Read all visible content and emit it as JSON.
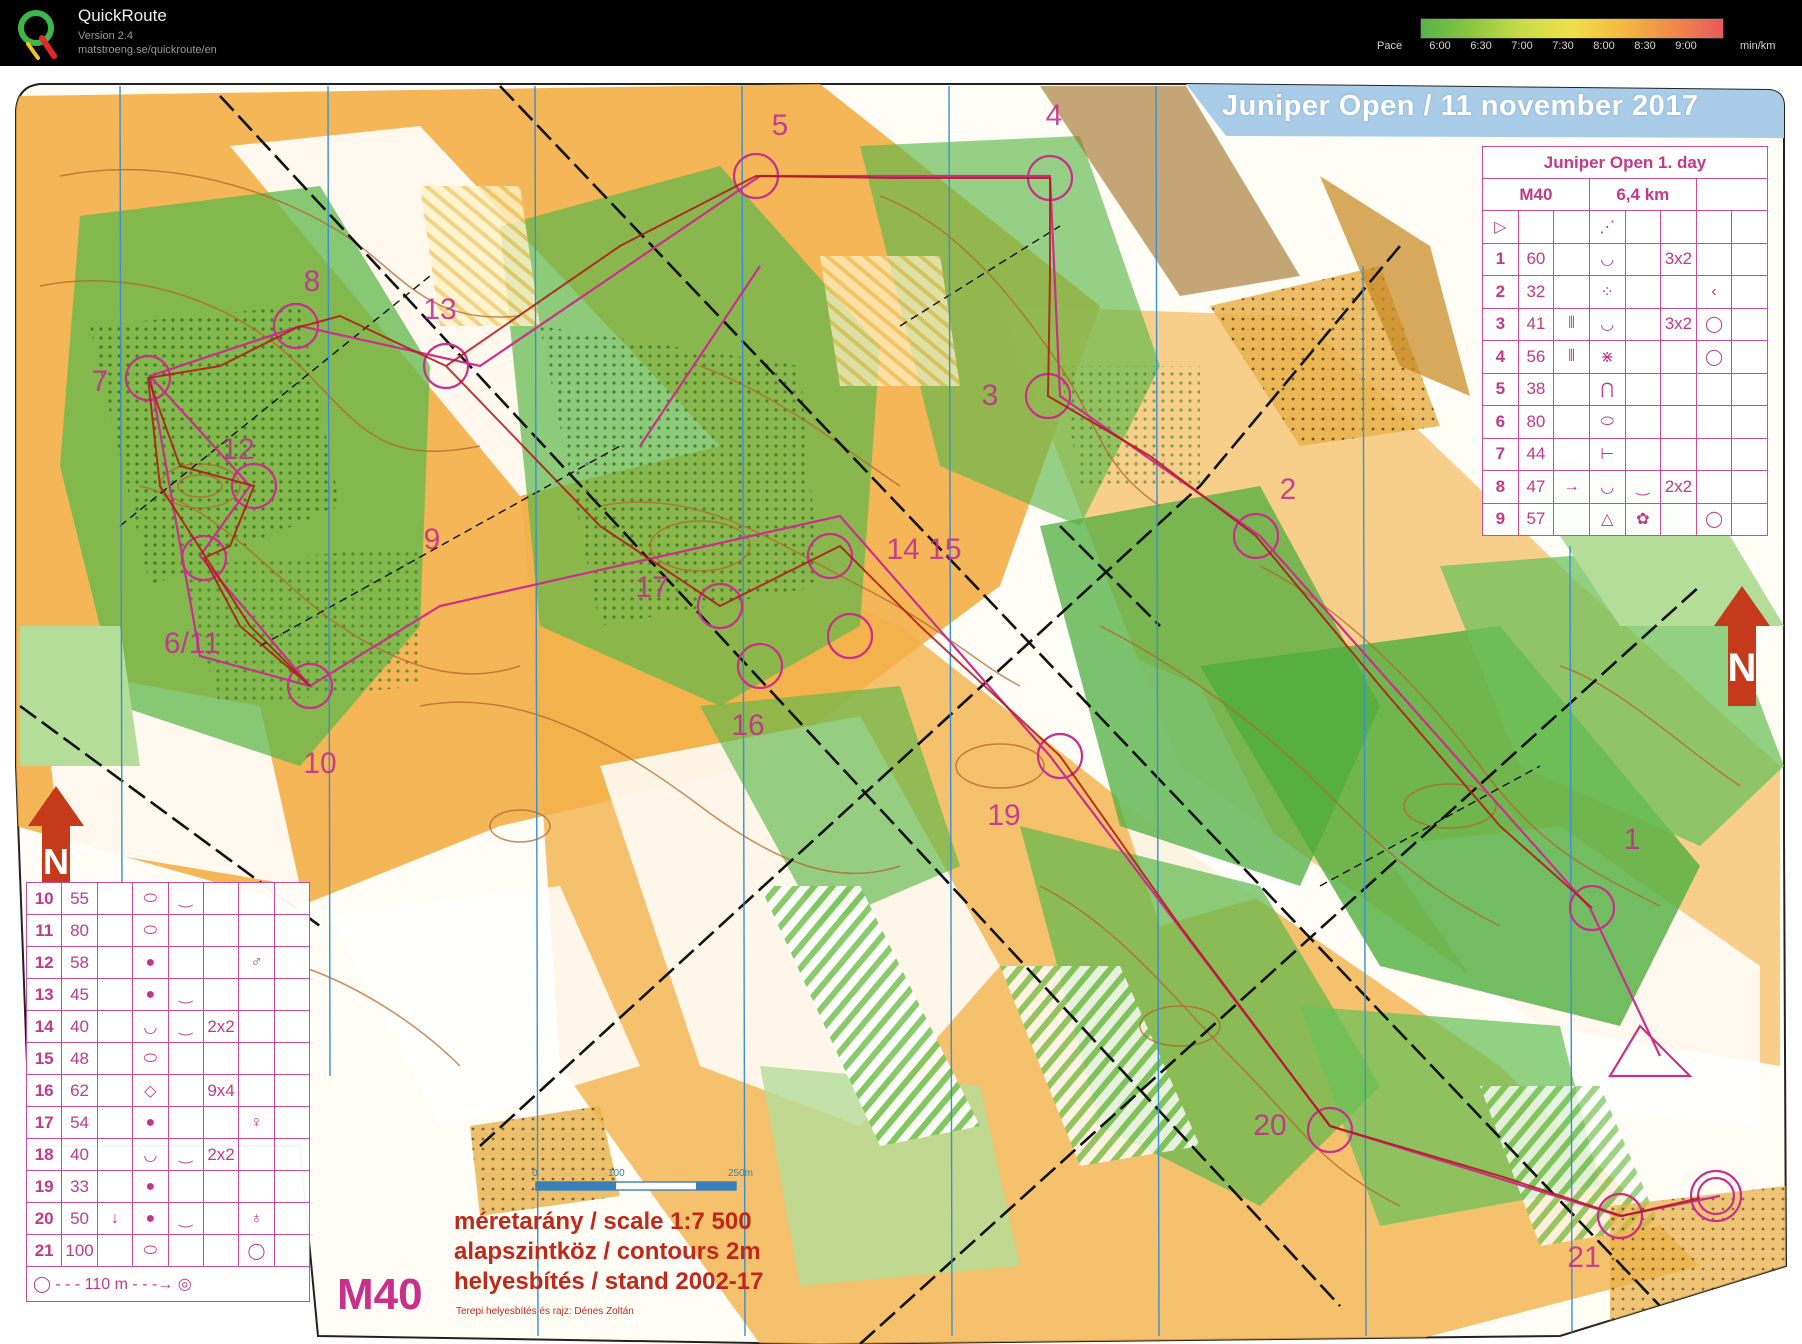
{
  "app": {
    "name": "QuickRoute",
    "version": "Version 2.4",
    "url": "matstroeng.se/quickroute/en"
  },
  "pace_scale": {
    "label": "Pace",
    "unit": "min/km",
    "ticks": [
      "6:00",
      "6:30",
      "7:00",
      "7:30",
      "8:00",
      "8:30",
      "9:00"
    ],
    "colors": [
      "#55b34a",
      "#8cc63f",
      "#c7dc4a",
      "#efe04a",
      "#f4b942",
      "#f08a4b",
      "#e85a5a"
    ]
  },
  "map": {
    "event_title": "Juniper Open  /  11 november 2017",
    "course_header": "Juniper Open 1. day",
    "course_class": "M40",
    "course_length": "6,4 km",
    "class_label": "M40",
    "scale_line": "méretarány / scale     1:7 500",
    "contours_line": "alapszintköz / contours  2m",
    "stand_line": "helyesbítés / stand   2002-17",
    "author_line": "Terepi helyesbítés és rajz: Dénes Zoltán",
    "scalebar_labels": [
      "0",
      "100",
      "250m"
    ],
    "final_leg": "110 m",
    "colors": {
      "forest_green": "#5db84a",
      "light_green": "#b4dd9a",
      "open_orange": "#f2a93a",
      "contour_brown": "#b5652a",
      "course_magenta": "#c8308c",
      "magnetic_blue": "#3a8fd0",
      "route_red": "#b01818"
    }
  },
  "control_descriptions": {
    "top": [
      {
        "num": "1",
        "code": "60",
        "a": "",
        "b": "◡",
        "c": "",
        "d": "3x2",
        "e": ""
      },
      {
        "num": "2",
        "code": "32",
        "a": "",
        "b": "⁘",
        "c": "",
        "d": "",
        "e": "‹"
      },
      {
        "num": "3",
        "code": "41",
        "a": "⫴",
        "b": "◡",
        "c": "",
        "d": "3x2",
        "e": "◯"
      },
      {
        "num": "4",
        "code": "56",
        "a": "⫴",
        "b": "⋇",
        "c": "",
        "d": "",
        "e": "◯"
      },
      {
        "num": "5",
        "code": "38",
        "a": "",
        "b": "⋂",
        "c": "",
        "d": "",
        "e": ""
      },
      {
        "num": "6",
        "code": "80",
        "a": "",
        "b": "⬭",
        "c": "",
        "d": "",
        "e": ""
      },
      {
        "num": "7",
        "code": "44",
        "a": "",
        "b": "⊢",
        "c": "",
        "d": "",
        "e": ""
      },
      {
        "num": "8",
        "code": "47",
        "a": "→",
        "b": "◡",
        "c": "‿",
        "d": "2x2",
        "e": ""
      },
      {
        "num": "9",
        "code": "57",
        "a": "",
        "b": "△",
        "c": "✿",
        "d": "",
        "e": "◯"
      }
    ],
    "bottom": [
      {
        "num": "10",
        "code": "55",
        "a": "",
        "b": "⬭",
        "c": "‿",
        "d": "",
        "e": ""
      },
      {
        "num": "11",
        "code": "80",
        "a": "",
        "b": "⬭",
        "c": "",
        "d": "",
        "e": ""
      },
      {
        "num": "12",
        "code": "58",
        "a": "",
        "b": "●",
        "c": "",
        "d": "",
        "e": "♂"
      },
      {
        "num": "13",
        "code": "45",
        "a": "",
        "b": "●",
        "c": "‿",
        "d": "",
        "e": ""
      },
      {
        "num": "14",
        "code": "40",
        "a": "",
        "b": "◡",
        "c": "‿",
        "d": "2x2",
        "e": ""
      },
      {
        "num": "15",
        "code": "48",
        "a": "",
        "b": "⬭",
        "c": "",
        "d": "",
        "e": ""
      },
      {
        "num": "16",
        "code": "62",
        "a": "",
        "b": "◇",
        "c": "",
        "d": "9x4",
        "e": ""
      },
      {
        "num": "17",
        "code": "54",
        "a": "",
        "b": "●",
        "c": "",
        "d": "",
        "e": "♀"
      },
      {
        "num": "18",
        "code": "40",
        "a": "",
        "b": "◡",
        "c": "‿",
        "d": "2x2",
        "e": ""
      },
      {
        "num": "19",
        "code": "33",
        "a": "",
        "b": "●",
        "c": "",
        "d": "",
        "e": ""
      },
      {
        "num": "20",
        "code": "50",
        "a": "↓",
        "b": "●",
        "c": "‿",
        "d": "",
        "e": "♁"
      },
      {
        "num": "21",
        "code": "100",
        "a": "",
        "b": "⬭",
        "c": "",
        "d": "",
        "e": "◯"
      }
    ]
  },
  "control_labels": [
    {
      "id": "1",
      "text": "1"
    },
    {
      "id": "2",
      "text": "2"
    },
    {
      "id": "3",
      "text": "3"
    },
    {
      "id": "4",
      "text": "4"
    },
    {
      "id": "5",
      "text": "5"
    },
    {
      "id": "7",
      "text": "7"
    },
    {
      "id": "8",
      "text": "8"
    },
    {
      "id": "9",
      "text": "9"
    },
    {
      "id": "10",
      "text": "10"
    },
    {
      "id": "611",
      "text": "6/11"
    },
    {
      "id": "12",
      "text": "12"
    },
    {
      "id": "13",
      "text": "13"
    },
    {
      "id": "1415",
      "text": "14 15"
    },
    {
      "id": "16",
      "text": "16"
    },
    {
      "id": "17",
      "text": "17"
    },
    {
      "id": "19",
      "text": "19"
    },
    {
      "id": "20",
      "text": "20"
    },
    {
      "id": "21",
      "text": "21"
    }
  ]
}
